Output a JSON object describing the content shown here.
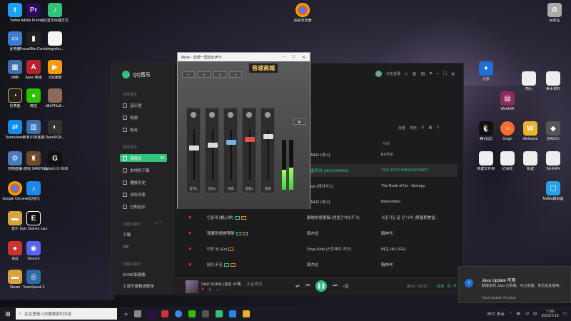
{
  "desktop_icons": {
    "twitter": "Twitter",
    "premiere": "Adobe Premie...",
    "qqmusic_shortcut": "QQ音乐快捷方式",
    "chrome_top": "谷歌浏览器",
    "recycle": "回收",
    "computer": "此电脑",
    "fl": "FocusRite Control",
    "bing": "bingyshu...",
    "network": "网络",
    "apex": "Apex 英雄",
    "ping": "X加速器",
    "speed": "仪表盘",
    "wechat": "微信",
    "file1": "d8d743a8...",
    "teamviewer": "TeamViewer",
    "tool1": "所有USB连接",
    "overwolf": "OpenRGB...",
    "control": "控制面板",
    "game": "小游戏 SAMP 测试",
    "logitech": "Logitech G HUB",
    "chrome_left": "Google Chrome",
    "epic": "Epic Games Launcher",
    "qqmusic_left": "QQ音乐",
    "music_left": "音乐",
    "discord": "Discord",
    "recorder": "录屏",
    "tencent": "TeamSpeak 3",
    "misc": "Steam",
    "right_app": "迅雷",
    "rar": "WinRAR",
    "qq": "腾讯QQ",
    "origin": "Origin",
    "wegame": "WeGame",
    "gamexiv": "游戏XIV",
    "r_doc1": "简历",
    "r_doc2": "美术资料",
    "r_doc3": "新建文件夹",
    "r_doc4": "记事本",
    "r_doc5": "新建",
    "r_doc6": "WinRAR",
    "r_doc7": "MuMu模拟器",
    "top_right": "回收站"
  },
  "qq_music": {
    "app_name": "QQ音乐",
    "online_music_section": "在线音乐",
    "my_music_section": "我的音乐",
    "created_playlists_section": "创建的歌单",
    "collected_playlists_section": "收藏的歌单",
    "sidebar": [
      {
        "label": "音乐馆"
      },
      {
        "label": "视频"
      },
      {
        "label": "电台"
      }
    ],
    "my_music": [
      {
        "label": "我喜欢",
        "count": "99"
      },
      {
        "label": "本地和下载"
      },
      {
        "label": "播放历史"
      },
      {
        "label": "试听列表"
      },
      {
        "label": "已购音乐"
      }
    ],
    "created_playlists": [
      "下载",
      "zzz"
    ],
    "collected_playlists": [
      "ROSÉ新歌集",
      "上海节奏精选歌单"
    ],
    "user_name": "点击登录",
    "list_tools": [
      "批量",
      "排序"
    ],
    "col_album": "专辑",
    "songs": [
      {
        "title": "",
        "artist": "INNER (위너)",
        "album": "EXIT:E",
        "highlight": false,
        "green": false
      },
      {
        "title": "",
        "artist": "水晶男孩 (SECHSKIES)",
        "album": "THE 20TH ANNIVERSARY",
        "highlight": true,
        "green": true
      },
      {
        "title": "",
        "artist": "day6 (데이식스)",
        "album": "The Book of Us : Entropy",
        "highlight": false,
        "green": false
      },
      {
        "title": "",
        "artist": "INNER (위너)",
        "album": "Remember",
        "highlight": false,
        "green": false
      },
      {
        "title": "인들레 (鷹心隊)",
        "artist": "鄭皚的恩惠輯 (명품간석송주기)",
        "album": "사춘기집 끝 온 나비 (思春期食堂...",
        "highlight": false,
        "green": false
      },
      {
        "title": "我要别想睡等静",
        "artist": "周杰伦",
        "album": "胸神代",
        "highlight": false,
        "green": false
      },
      {
        "title": "미친 놈 (Ex)",
        "artist": "Stray Kids (스트레이 키즈)",
        "album": "IN生 (IN LIFE)",
        "highlight": false,
        "green": false
      },
      {
        "title": "好久不见",
        "artist": "周杰伦",
        "album": "胸神代",
        "highlight": false,
        "green": false
      }
    ],
    "player": {
      "now_playing": "SAD SONG (슬픈 노래)",
      "artist": "- 水晶男孩",
      "time": "00:37 / 03:27",
      "quality": "标准",
      "progress": 0.18
    }
  },
  "mixer": {
    "title": "Mixer - 音频一调音台声卡",
    "brand": "音速商城",
    "strips": [
      "音色1",
      "音色2",
      "伴奏",
      "音量1",
      "混响"
    ],
    "buttons": [
      "1",
      "2",
      "3",
      "4"
    ]
  },
  "notification": {
    "title": "Java Update 可用",
    "message": "新版本的 Java 已就绪。可以安装。单击此处继续。",
    "source": "Java Update Checker"
  },
  "taskbar": {
    "search_placeholder": "在这里输入你要搜索的内容",
    "weather": "28°C 多云",
    "ime": "中",
    "time": "7:30",
    "date": "2021/7/16"
  }
}
